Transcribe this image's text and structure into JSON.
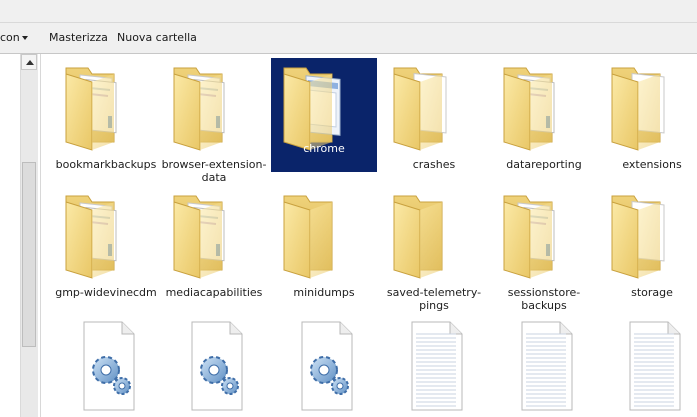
{
  "toolbar": {
    "partial_left_label": "con",
    "burn_label": "Masterizza",
    "new_folder_label": "Nuova cartella"
  },
  "colors": {
    "selection": "#0a246a",
    "folder_front": "#f7df8f",
    "folder_back": "#e6c86a"
  },
  "items": [
    {
      "label": "bookmarkbackups",
      "icon": "folder-documents-icon",
      "selected": false
    },
    {
      "label": "browser-extension-data",
      "icon": "folder-documents-icon",
      "selected": false
    },
    {
      "label": "chrome",
      "icon": "folder-window-icon",
      "selected": true
    },
    {
      "label": "crashes",
      "icon": "folder-paper-icon",
      "selected": false
    },
    {
      "label": "datareporting",
      "icon": "folder-documents-icon",
      "selected": false
    },
    {
      "label": "extensions",
      "icon": "folder-paper-icon",
      "selected": false
    },
    {
      "label": "gmp-widevinecdm",
      "icon": "folder-documents-icon",
      "selected": false
    },
    {
      "label": "mediacapabilities",
      "icon": "folder-documents-icon",
      "selected": false
    },
    {
      "label": "minidumps",
      "icon": "folder-empty-icon",
      "selected": false
    },
    {
      "label": "saved-telemetry-pings",
      "icon": "folder-empty-icon",
      "selected": false
    },
    {
      "label": "sessionstore-backups",
      "icon": "folder-documents-icon",
      "selected": false
    },
    {
      "label": "storage",
      "icon": "folder-paper-icon",
      "selected": false
    },
    {
      "label": "",
      "icon": "settings-file-icon",
      "selected": false
    },
    {
      "label": "",
      "icon": "settings-file-icon",
      "selected": false
    },
    {
      "label": "",
      "icon": "settings-file-icon",
      "selected": false
    },
    {
      "label": "",
      "icon": "text-file-icon",
      "selected": false
    },
    {
      "label": "",
      "icon": "text-file-icon",
      "selected": false
    },
    {
      "label": "",
      "icon": "text-file-icon",
      "selected": false
    }
  ]
}
